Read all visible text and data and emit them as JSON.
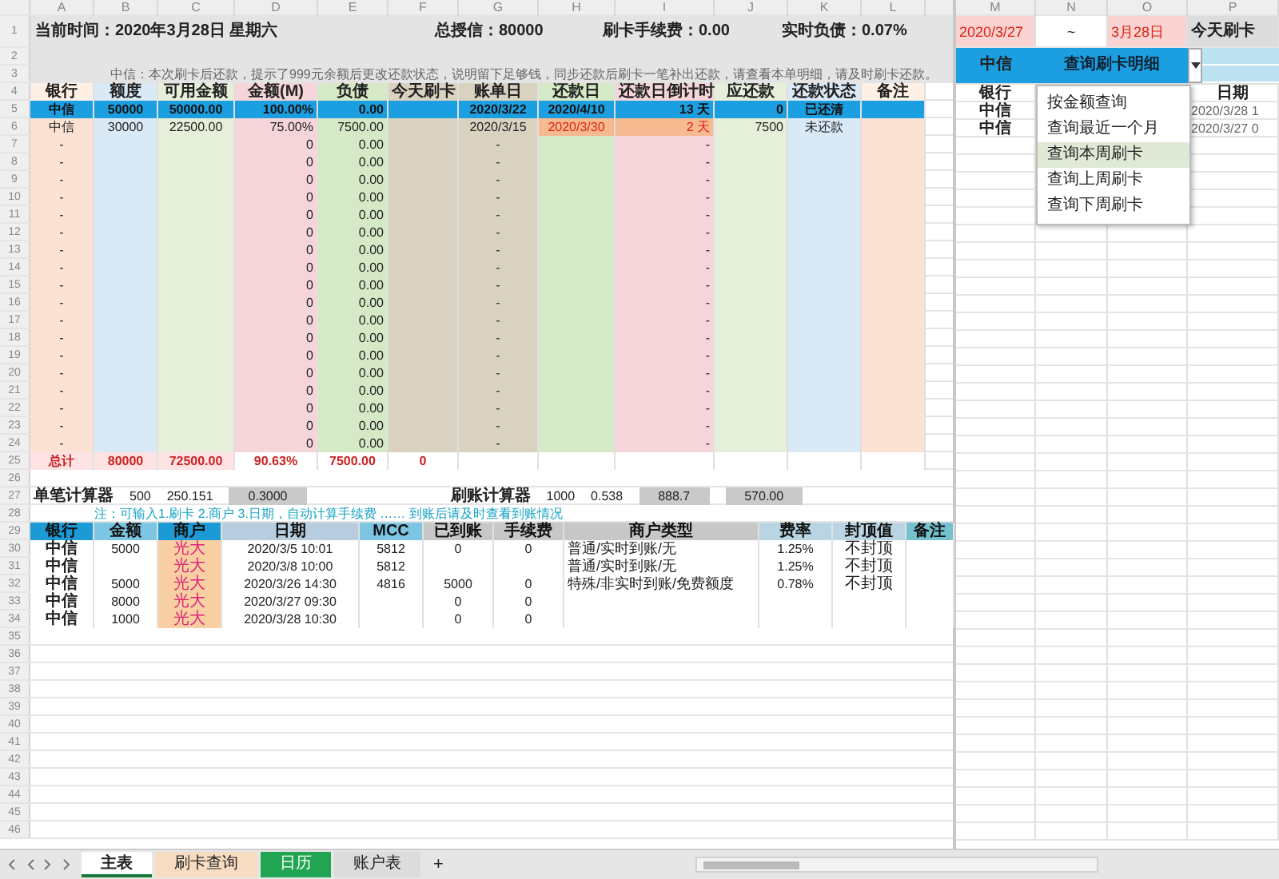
{
  "header": {
    "time": "当前时间：2020年3月28日 星期六",
    "credit": "总授信：80000",
    "fee": "刷卡手续费：0.00",
    "debt": "实时负债：0.07%"
  },
  "column_letters": [
    "A",
    "B",
    "C",
    "D",
    "E",
    "F",
    "G",
    "H",
    "I",
    "J",
    "K",
    "L"
  ],
  "right_column_letters": [
    "M",
    "N",
    "O",
    "P"
  ],
  "row_numbers": [
    "1",
    "2",
    "3",
    "4",
    "5",
    "6",
    "7",
    "8",
    "9",
    "10",
    "11",
    "12",
    "13",
    "14",
    "15",
    "16",
    "17",
    "18",
    "19",
    "20",
    "21",
    "22",
    "23",
    "24",
    "25",
    "26",
    "27",
    "28",
    "29",
    "30",
    "31",
    "32",
    "33",
    "34",
    "35",
    "36",
    "37",
    "38",
    "39",
    "40",
    "41",
    "42",
    "43",
    "44",
    "45",
    "46"
  ],
  "note": "中信：本次刷卡后还款，提示了999元余额后更改还款状态，说明留下足够钱，同步还款后刷卡一笔补出还款，请查看本单明细，请及时刷卡还款。",
  "main_table": {
    "columns": [
      "银行",
      "额度",
      "可用金额",
      "金额(M)",
      "负债",
      "今天刷卡",
      "账单日",
      "还款日",
      "还款日倒计时",
      "应还款",
      "还款状态",
      "备注"
    ],
    "rows": [
      {
        "selected": true,
        "urgent": false,
        "cells": [
          "中信",
          "50000",
          "50000.00",
          "100.00%",
          "0.00",
          null,
          "2020/3/22",
          "2020/4/10",
          "13 天",
          "0",
          "已还清",
          null
        ]
      },
      {
        "selected": false,
        "urgent": true,
        "cells": [
          "中信",
          "30000",
          "22500.00",
          "75.00%",
          "7500.00",
          null,
          "2020/3/15",
          "2020/3/30",
          "2 天",
          "7500",
          "未还款",
          null
        ]
      },
      {
        "selected": false,
        "urgent": false,
        "cells": [
          "-",
          null,
          null,
          "0",
          "0.00",
          null,
          "-",
          null,
          "-",
          null,
          null,
          null
        ]
      },
      {
        "selected": false,
        "urgent": false,
        "cells": [
          "-",
          null,
          null,
          "0",
          "0.00",
          null,
          "-",
          null,
          "-",
          null,
          null,
          null
        ]
      },
      {
        "selected": false,
        "urgent": false,
        "cells": [
          "-",
          null,
          null,
          "0",
          "0.00",
          null,
          "-",
          null,
          "-",
          null,
          null,
          null
        ]
      },
      {
        "selected": false,
        "urgent": false,
        "cells": [
          "-",
          null,
          null,
          "0",
          "0.00",
          null,
          "-",
          null,
          "-",
          null,
          null,
          null
        ]
      },
      {
        "selected": false,
        "urgent": false,
        "cells": [
          "-",
          null,
          null,
          "0",
          "0.00",
          null,
          "-",
          null,
          "-",
          null,
          null,
          null
        ]
      },
      {
        "selected": false,
        "urgent": false,
        "cells": [
          "-",
          null,
          null,
          "0",
          "0.00",
          null,
          "-",
          null,
          "-",
          null,
          null,
          null
        ]
      },
      {
        "selected": false,
        "urgent": false,
        "cells": [
          "-",
          null,
          null,
          "0",
          "0.00",
          null,
          "-",
          null,
          "-",
          null,
          null,
          null
        ]
      },
      {
        "selected": false,
        "urgent": false,
        "cells": [
          "-",
          null,
          null,
          "0",
          "0.00",
          null,
          "-",
          null,
          "-",
          null,
          null,
          null
        ]
      },
      {
        "selected": false,
        "urgent": false,
        "cells": [
          "-",
          null,
          null,
          "0",
          "0.00",
          null,
          "-",
          null,
          "-",
          null,
          null,
          null
        ]
      },
      {
        "selected": false,
        "urgent": false,
        "cells": [
          "-",
          null,
          null,
          "0",
          "0.00",
          null,
          "-",
          null,
          "-",
          null,
          null,
          null
        ]
      },
      {
        "selected": false,
        "urgent": false,
        "cells": [
          "-",
          null,
          null,
          "0",
          "0.00",
          null,
          "-",
          null,
          "-",
          null,
          null,
          null
        ]
      },
      {
        "selected": false,
        "urgent": false,
        "cells": [
          "-",
          null,
          null,
          "0",
          "0.00",
          null,
          "-",
          null,
          "-",
          null,
          null,
          null
        ]
      },
      {
        "selected": false,
        "urgent": false,
        "cells": [
          "-",
          null,
          null,
          "0",
          "0.00",
          null,
          "-",
          null,
          "-",
          null,
          null,
          null
        ]
      },
      {
        "selected": false,
        "urgent": false,
        "cells": [
          "-",
          null,
          null,
          "0",
          "0.00",
          null,
          "-",
          null,
          "-",
          null,
          null,
          null
        ]
      },
      {
        "selected": false,
        "urgent": false,
        "cells": [
          "-",
          null,
          null,
          "0",
          "0.00",
          null,
          "-",
          null,
          "-",
          null,
          null,
          null
        ]
      },
      {
        "selected": false,
        "urgent": false,
        "cells": [
          "-",
          null,
          null,
          "0",
          "0.00",
          null,
          "-",
          null,
          "-",
          null,
          null,
          null
        ]
      },
      {
        "selected": false,
        "urgent": false,
        "cells": [
          "-",
          null,
          null,
          "0",
          "0.00",
          null,
          "-",
          null,
          "-",
          null,
          null,
          null
        ]
      },
      {
        "selected": false,
        "urgent": false,
        "cells": [
          "-",
          null,
          null,
          "0",
          "0.00",
          null,
          "-",
          null,
          "-",
          null,
          null,
          null
        ]
      }
    ],
    "total": [
      "总计",
      "80000",
      "72500.00",
      "90.63%",
      "7500.00",
      "0"
    ]
  },
  "calculators": [
    {
      "label": "单笔计算器",
      "inputs": [
        "500",
        "250.151"
      ],
      "outputs": [
        "0.3000"
      ]
    },
    {
      "label": "刷账计算器",
      "inputs": [
        "1000",
        "0.538"
      ],
      "outputs": [
        "888.7",
        "570.00"
      ]
    }
  ],
  "swipe_note": "注：可输入1.刷卡 2.商户 3.日期，自动计算手续费  ……  到账后请及时查看到账情况",
  "swipe_table": {
    "columns": [
      "银行",
      "金额",
      "商户",
      "日期",
      "MCC",
      "已到账",
      "手续费",
      "商户类型",
      "费率",
      "封顶值",
      "备注"
    ],
    "rows": [
      {
        "cells": [
          "中信",
          "5000",
          "光大",
          "2020/3/5 10:01",
          "5812",
          "0",
          "0",
          "普通/实时到账/无",
          "1.25%",
          "不封顶",
          null
        ]
      },
      {
        "cells": [
          "中信",
          null,
          "光大",
          "2020/3/8 10:00",
          "5812",
          null,
          null,
          "普通/实时到账/无",
          "1.25%",
          "不封顶",
          null
        ]
      },
      {
        "cells": [
          "中信",
          "5000",
          "光大",
          "2020/3/26 14:30",
          "4816",
          "5000",
          "0",
          "特殊/非实时到账/免费额度",
          "0.78%",
          "不封顶",
          null
        ]
      },
      {
        "cells": [
          "中信",
          "8000",
          "光大",
          "2020/3/27 09:30",
          null,
          "0",
          "0",
          null,
          null,
          null,
          null
        ]
      },
      {
        "cells": [
          "中信",
          "1000",
          "光大",
          "2020/3/28 10:30",
          null,
          "0",
          "0",
          null,
          null,
          null,
          null
        ]
      }
    ]
  },
  "query_panel": {
    "date_from": "2020/3/27",
    "separator": "~",
    "date_to": "3月28日",
    "today_label": "今天刷卡",
    "bank": "中信",
    "mode": "查询刷卡明细",
    "menu": [
      {
        "label": "按金额查询",
        "selected": false
      },
      {
        "label": "查询最近一个月",
        "selected": false
      },
      {
        "label": "查询本周刷卡",
        "selected": true
      },
      {
        "label": "查询上周刷卡",
        "selected": false
      },
      {
        "label": "查询下周刷卡",
        "selected": false
      }
    ],
    "columns": [
      "银行",
      "日期"
    ],
    "rows": [
      {
        "bank": "中信",
        "date": "2020/3/28 1"
      },
      {
        "bank": "中信",
        "date": "2020/3/27 0"
      }
    ]
  },
  "sheet_tabs": [
    {
      "label": "主表",
      "selected": true,
      "color": "#ffffff"
    },
    {
      "label": "刷卡查询",
      "selected": false,
      "color": "#f8dcc2"
    },
    {
      "label": "日历",
      "selected": false,
      "color": "#21a552"
    },
    {
      "label": "账户表",
      "selected": false,
      "color": "#dcdcdc"
    }
  ],
  "add_sheet": "+"
}
